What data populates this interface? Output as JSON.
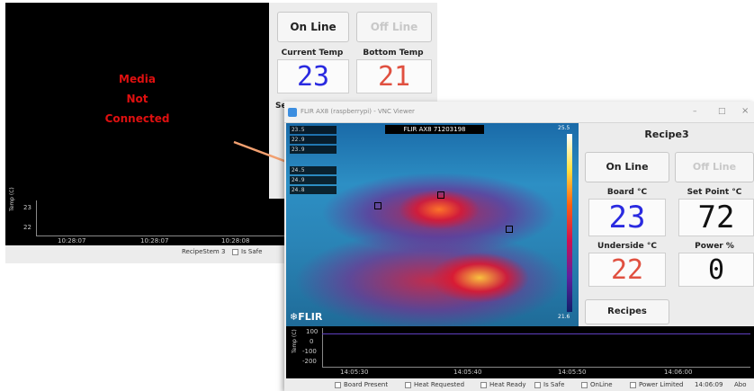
{
  "back_window": {
    "media_line1": "Media",
    "media_line2": "Not",
    "media_line3": "Connected",
    "online_label": "On Line",
    "offline_label": "Off Line",
    "current_temp_label": "Current Temp",
    "bottom_temp_label": "Bottom Temp",
    "current_temp_value": "23",
    "bottom_temp_value": "21",
    "setpoint_label_partial": "Set Point",
    "graph_axis_label": "Temp (C)",
    "graph_y_ticks": [
      "23",
      "22"
    ],
    "graph_x_ticks": [
      "10:28:07",
      "10:28:07",
      "10:28:08"
    ],
    "status_recipe": "RecipeStem 3",
    "status_is_safe": "Is Safe"
  },
  "front_window": {
    "title": "FLIR AX8 (raspberrypi) - VNC Viewer",
    "thermal_header": "FLIR AX8 71203198",
    "scale_max": "25.5",
    "scale_min": "21.6",
    "flir_logo": "FLIR",
    "spot_tags": [
      "23.5",
      "22.9",
      "23.9",
      "24.5",
      "24.9",
      "24.8"
    ],
    "recipe_name": "Recipe3",
    "online_label": "On Line",
    "offline_label": "Off Line",
    "board_label": "Board °C",
    "setpoint_label": "Set Point °C",
    "board_value": "23",
    "setpoint_value": "72",
    "underside_label": "Underside °C",
    "power_label": "Power %",
    "underside_value": "22",
    "power_value": "0",
    "recipes_button": "Recipes",
    "graph_axis_label": "Temp (C)",
    "graph_y_ticks": [
      "100",
      "0",
      "-100",
      "-200"
    ],
    "graph_x_ticks": [
      "14:05:30",
      "14:05:40",
      "14:05:50",
      "14:06:00"
    ],
    "status": {
      "board_present": "Board Present",
      "heat_requested": "Heat Requested",
      "heat_ready": "Heat Ready",
      "is_safe": "Is Safe",
      "online": "OnLine",
      "power_limited": "Power Limited",
      "time": "14:06:09",
      "about": "Abo"
    }
  },
  "colors": {
    "arrow": "#f2a070",
    "media_red": "#e01010",
    "value_blue": "#2a2ae0",
    "value_red": "#e05040",
    "value_black": "#111111",
    "graph_line": "#6040c0"
  }
}
